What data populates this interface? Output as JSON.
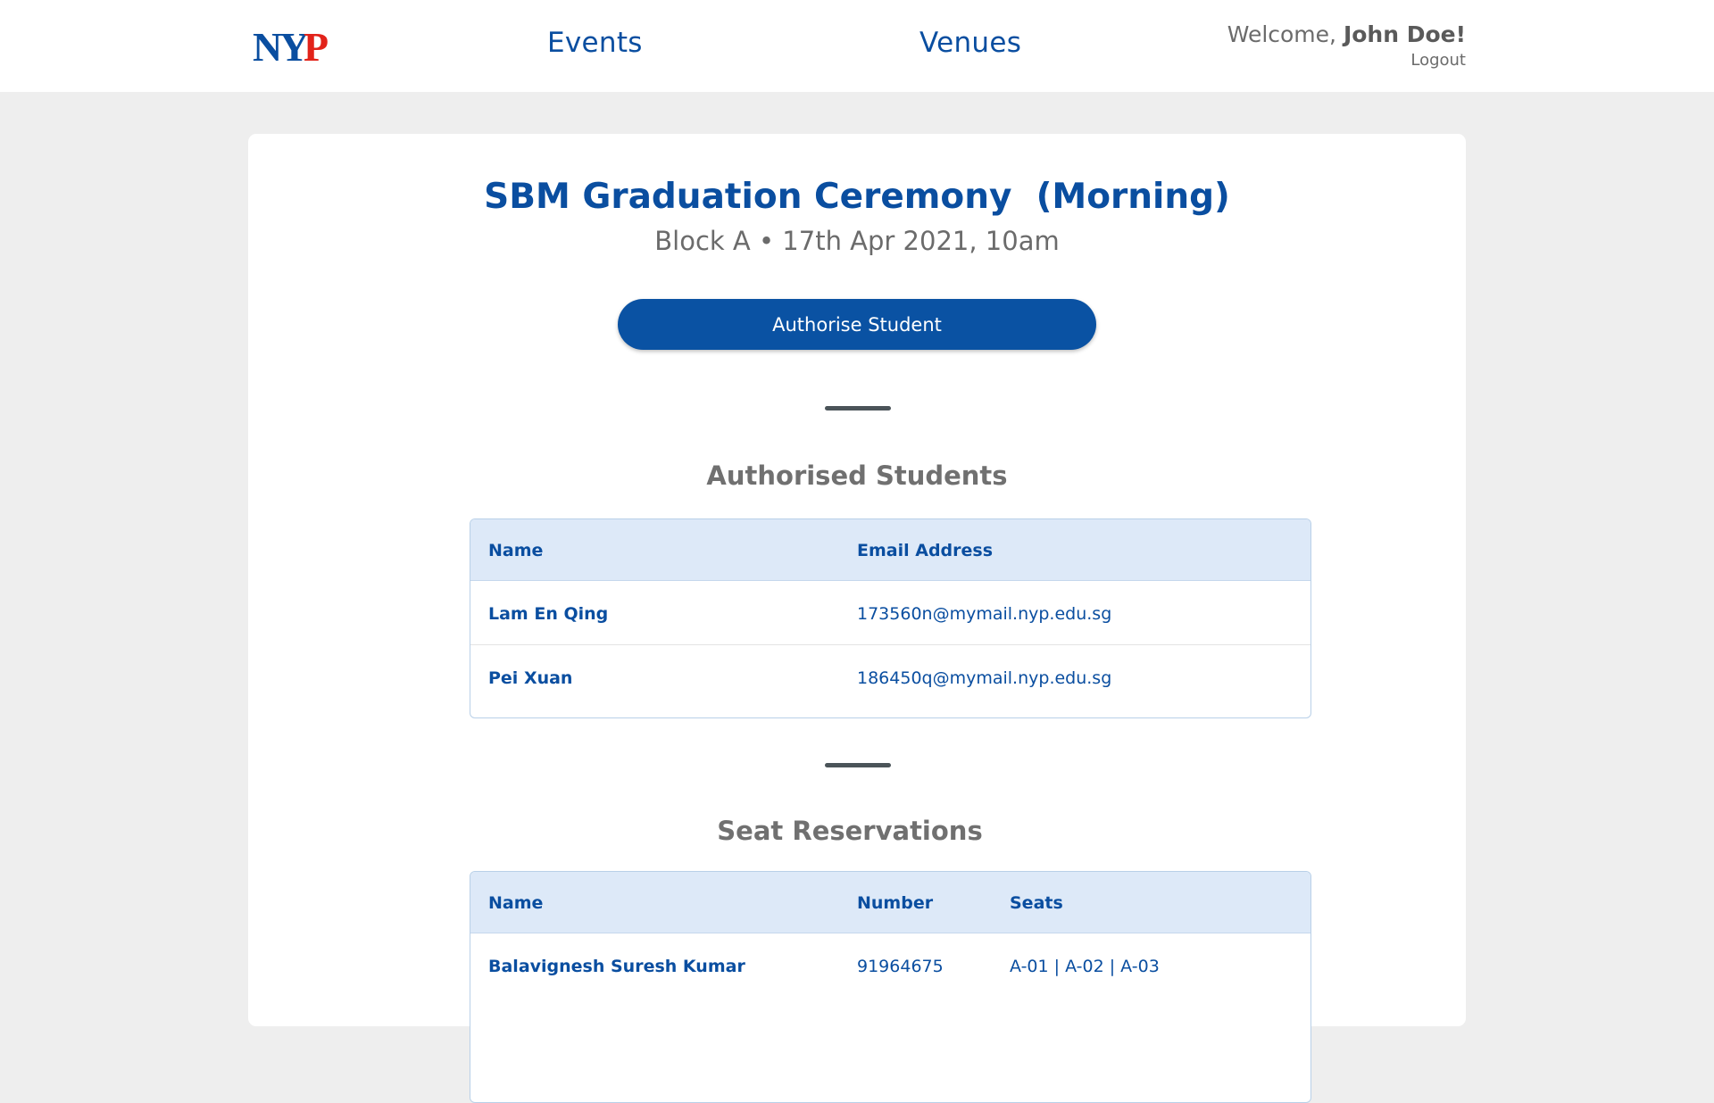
{
  "header": {
    "logo_text": "NYP",
    "nav": {
      "events": "Events",
      "venues": "Venues"
    },
    "welcome_prefix": "Welcome, ",
    "user_name": "John Doe!",
    "logout": "Logout"
  },
  "event": {
    "title": "SBM Graduation Ceremony  (Morning)",
    "subtitle": "Block A • 17th Apr 2021, 10am",
    "authorise_button": "Authorise Student"
  },
  "authorised": {
    "title": "Authorised Students",
    "columns": {
      "name": "Name",
      "email": "Email Address"
    },
    "rows": [
      {
        "name": "Lam En Qing",
        "email": "173560n@mymail.nyp.edu.sg"
      },
      {
        "name": "Pei Xuan",
        "email": "186450q@mymail.nyp.edu.sg"
      }
    ]
  },
  "reservations": {
    "title": "Seat Reservations",
    "columns": {
      "name": "Name",
      "number": "Number",
      "seats": "Seats"
    },
    "rows": [
      {
        "name": "Balavignesh Suresh Kumar",
        "number": "91964675",
        "seats": "A-01 | A-02 | A-03"
      }
    ]
  },
  "colors": {
    "brand_blue": "#0a4ea0",
    "button_blue": "#0a52a3",
    "logo_red": "#e2231a",
    "table_header_bg": "#dde9f8"
  }
}
